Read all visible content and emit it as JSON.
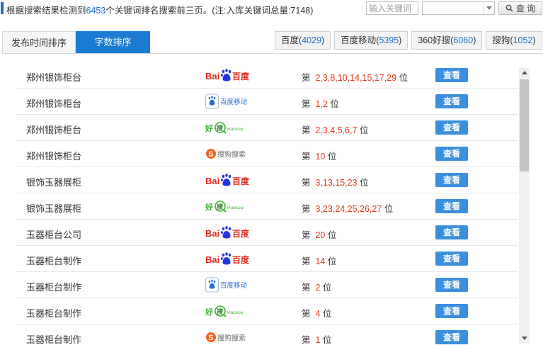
{
  "header": {
    "summary_prefix": "根据搜索结果检测到",
    "summary_count": "6453",
    "summary_suffix": "个关键词排名搜索前三页。(注:入库关键词总量:7148)",
    "keyword_placeholder": "输入关键词",
    "select_value": "",
    "query_label": "查 询"
  },
  "tabs": [
    {
      "label": "发布时间排序",
      "active": false
    },
    {
      "label": "字数排序",
      "active": true
    }
  ],
  "engines": [
    {
      "name": "百度",
      "count": "4029"
    },
    {
      "name": "百度移动",
      "count": "5395"
    },
    {
      "name": "360好搜",
      "count": "6060"
    },
    {
      "name": "搜狗",
      "count": "1052"
    }
  ],
  "rows": [
    {
      "keyword": "郑州银饰柜台",
      "engine": "baidu",
      "rank_prefix": "第",
      "positions": "2,3,8,10,14,15,17,29",
      "rank_suffix": "位",
      "view": "查看"
    },
    {
      "keyword": "郑州银饰柜台",
      "engine": "baidu-mobile",
      "rank_prefix": "第",
      "positions": "1,2",
      "rank_suffix": "位",
      "view": "查看"
    },
    {
      "keyword": "郑州银饰柜台",
      "engine": "haosou",
      "rank_prefix": "第",
      "positions": "2,3,4,5,6,7",
      "rank_suffix": "位",
      "view": "查看"
    },
    {
      "keyword": "郑州银饰柜台",
      "engine": "sogou",
      "rank_prefix": "第",
      "positions": "10",
      "rank_suffix": "位",
      "view": "查看"
    },
    {
      "keyword": "银饰玉器展柜",
      "engine": "baidu",
      "rank_prefix": "第",
      "positions": "3,13,15,23",
      "rank_suffix": "位",
      "view": "查看"
    },
    {
      "keyword": "银饰玉器展柜",
      "engine": "haosou",
      "rank_prefix": "第",
      "positions": "3,23,24,25,26,27",
      "rank_suffix": "位",
      "view": "查看"
    },
    {
      "keyword": "玉器柜台公司",
      "engine": "baidu",
      "rank_prefix": "第",
      "positions": "20",
      "rank_suffix": "位",
      "view": "查看"
    },
    {
      "keyword": "玉器柜台制作",
      "engine": "baidu",
      "rank_prefix": "第",
      "positions": "14",
      "rank_suffix": "位",
      "view": "查看"
    },
    {
      "keyword": "玉器柜台制作",
      "engine": "baidu-mobile",
      "rank_prefix": "第",
      "positions": "2",
      "rank_suffix": "位",
      "view": "查看"
    },
    {
      "keyword": "玉器柜台制作",
      "engine": "haosou",
      "rank_prefix": "第",
      "positions": "4",
      "rank_suffix": "位",
      "view": "查看"
    },
    {
      "keyword": "玉器柜台制作",
      "engine": "sogou",
      "rank_prefix": "第",
      "positions": "1",
      "rank_suffix": "位",
      "view": "查看"
    }
  ],
  "logos": {
    "baidu": {
      "left": "Bai",
      "right": "百度",
      "colors": {
        "red": "#de2a1f",
        "blue": "#2932e1"
      }
    },
    "baidu-mobile": {
      "text": "百度移动",
      "colors": {
        "red": "#de2a1f",
        "blue": "#2a6fd6"
      }
    },
    "haosou": {
      "cn1": "好",
      "cn2": "搜",
      "en": "Haosou",
      "colors": {
        "green": "#3fb335",
        "dark": "#2d8a2a"
      }
    },
    "sogou": {
      "text": "搜狗搜索",
      "colors": {
        "orange": "#f2631a",
        "gray": "#666666"
      }
    }
  },
  "colors": {
    "accent": "#1a7bd1",
    "link_count": "#1e72c8",
    "rank_red": "#e03a1e",
    "view_button": "#3c8fde"
  }
}
